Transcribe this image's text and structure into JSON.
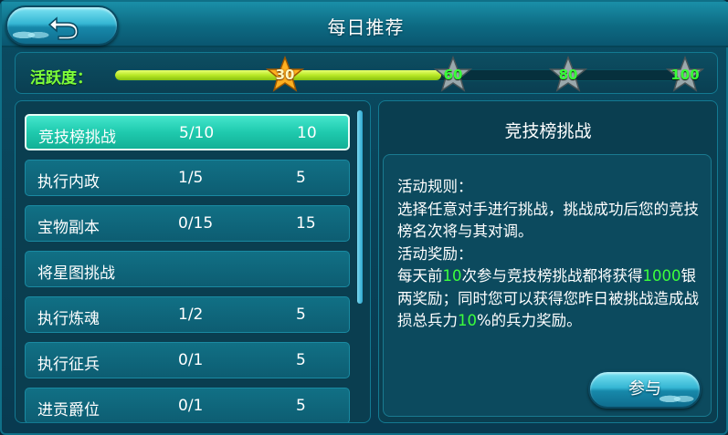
{
  "header": {
    "title": "每日推荐"
  },
  "activity": {
    "label": "活跃度：",
    "progress_percent": 56,
    "milestones": [
      {
        "value": "30",
        "reached": true
      },
      {
        "value": "60",
        "reached": false
      },
      {
        "value": "80",
        "reached": false
      },
      {
        "value": "100",
        "reached": false
      }
    ]
  },
  "tasks": [
    {
      "name": "竞技榜挑战",
      "progress": "5/10",
      "points": "10"
    },
    {
      "name": "执行内政",
      "progress": "1/5",
      "points": "5"
    },
    {
      "name": "宝物副本",
      "progress": "0/15",
      "points": "15"
    },
    {
      "name": "将星图挑战",
      "progress": "",
      "points": ""
    },
    {
      "name": "执行炼魂",
      "progress": "1/2",
      "points": "5"
    },
    {
      "name": "执行征兵",
      "progress": "0/1",
      "points": "5"
    },
    {
      "name": "进贡爵位",
      "progress": "0/1",
      "points": "5"
    }
  ],
  "selected_task": 0,
  "detail": {
    "title": "竞技榜挑战",
    "rules_label": "活动规则：",
    "rules_text": "选择任意对手进行挑战，挑战成功后您的竞技榜名次将与其对调。",
    "reward_label": "活动奖励：",
    "reward_p1": "每天前",
    "reward_n1": "10",
    "reward_p2": "次参与竞技榜挑战都将获得",
    "reward_n2": "1000",
    "reward_p3": "银两奖励；同时您可以获得您昨日被挑战造成战损总兵力",
    "reward_n3": "10",
    "reward_p4": "%的兵力奖励。",
    "join_label": "参与"
  },
  "colors": {
    "highlight_green": "#3cff3c",
    "selected_row": "#1fcaae",
    "bar_fill": "#b8e826"
  }
}
